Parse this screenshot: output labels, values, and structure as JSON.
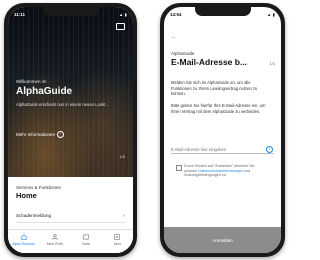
{
  "left": {
    "status": {
      "time": "11:11",
      "icons": "▲ ▮"
    },
    "hero": {
      "welcome": "Willkommen im",
      "title": "AlphaGuide",
      "subtitle": "AlphaGuide erscheint nun in einem neuen Look!...",
      "more_label": "Mehr Informationen",
      "pager": "1/3"
    },
    "sheet": {
      "kicker": "Services & Funktionen",
      "title": "Home",
      "row_label": "Schadenmeldung"
    },
    "tabs": [
      {
        "label": "Alpha Services",
        "icon": "home-icon"
      },
      {
        "label": "Mein Profil",
        "icon": "person-icon"
      },
      {
        "label": "Karte",
        "icon": "map-icon"
      },
      {
        "label": "Infos",
        "icon": "info-list-icon"
      }
    ]
  },
  "right": {
    "status": {
      "time": "14:54",
      "icons": "▲ ▮"
    },
    "kicker": "AlphaGuide",
    "title": "E-Mail-Adresse b...",
    "step": "1/3",
    "para1": "Melden Sie sich im AlphaGuide an, um alle Funktionen zu Ihrem Leasingvertrag nutzen zu können.",
    "para2": "Bitte geben Sie hierfür Ihre E-Mail-Adresse ein, um Ihren Vertrag mit dem AlphaGuide zu verbinden.",
    "email_placeholder": "E-Mail-Adresse hier eingeben",
    "consent_pre": "Durch Klicken auf \"Anmelden\" stimmen Sie unseren ",
    "consent_link": "Datenschutzbestimmungen",
    "consent_post": " und Nutzungsbedingungen zu.",
    "button_label": "Anmelden"
  },
  "colors": {
    "accent": "#1e88e5",
    "button_disabled": "#8c8c8c"
  }
}
